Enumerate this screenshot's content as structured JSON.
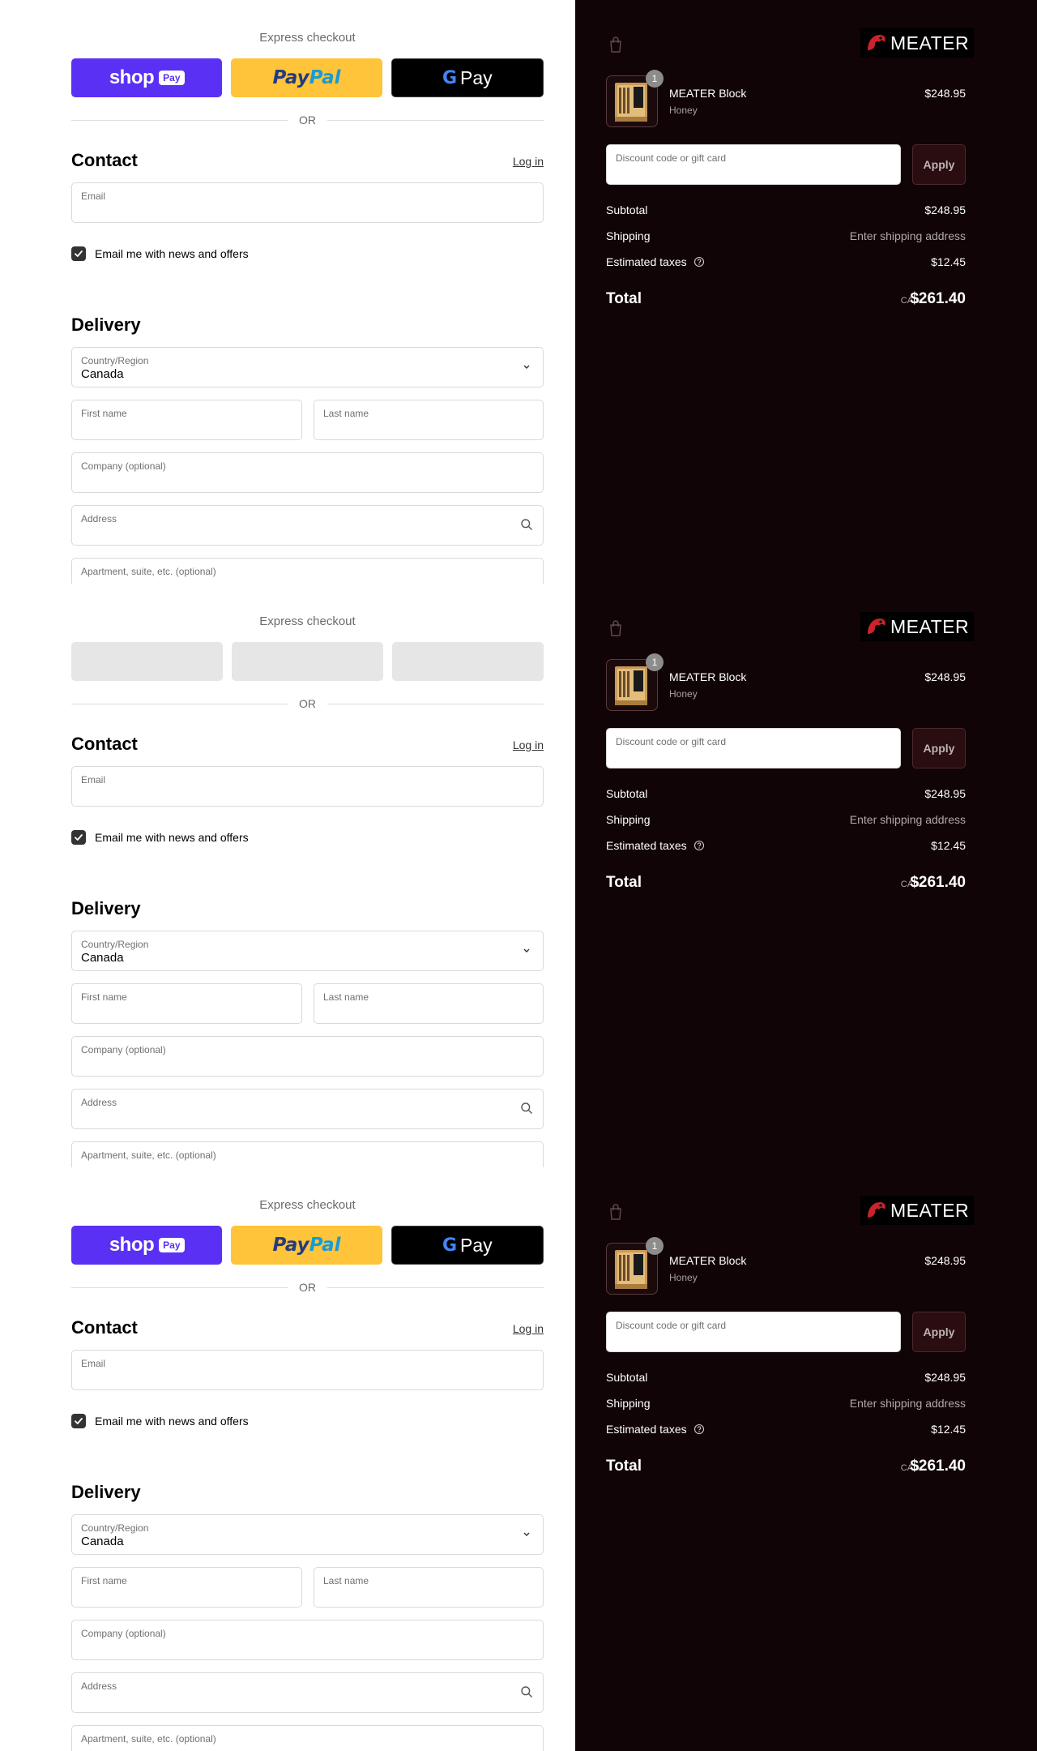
{
  "express": {
    "title": "Express checkout",
    "or_text": "OR",
    "shop_word": "shop",
    "shop_pay": "Pay",
    "paypal_a": "Pay",
    "paypal_b": "Pal",
    "gpay_g": "G",
    "gpay_word": "Pay"
  },
  "contact": {
    "title": "Contact",
    "login": "Log in",
    "email_label": "Email",
    "newsletter_label": "Email me with news and offers",
    "newsletter_checked": true
  },
  "delivery": {
    "title": "Delivery",
    "country_label": "Country/Region",
    "country_value": "Canada",
    "first_name_label": "First name",
    "last_name_label": "Last name",
    "company_label": "Company (optional)",
    "address_label": "Address",
    "apartment_label": "Apartment, suite, etc. (optional)"
  },
  "summary": {
    "brand": "MEATER",
    "item": {
      "name": "MEATER Block",
      "variant": "Honey",
      "quantity": "1",
      "price": "$248.95"
    },
    "discount_placeholder": "Discount code or gift card",
    "apply_label": "Apply",
    "subtotal_label": "Subtotal",
    "subtotal_value": "$248.95",
    "shipping_label": "Shipping",
    "shipping_value": "Enter shipping address",
    "taxes_label": "Estimated taxes",
    "taxes_value": "$12.45",
    "total_label": "Total",
    "total_currency": "CAD",
    "total_value": "$261.40"
  },
  "colors": {
    "shop_pay": "#5a31f4",
    "paypal": "#ffc439",
    "summary_bg": "#110406",
    "brand_red": "#c8242b"
  }
}
